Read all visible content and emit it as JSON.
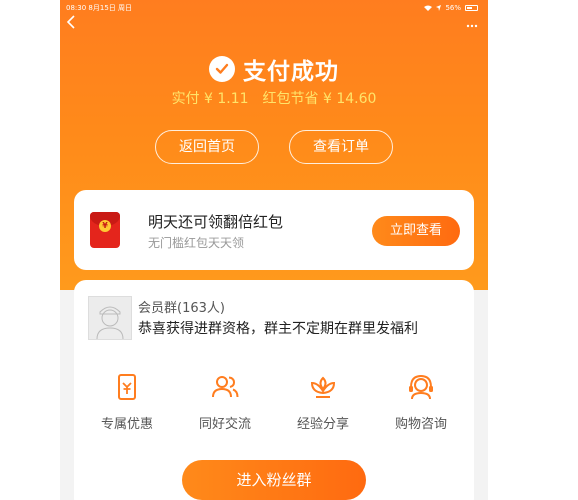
{
  "status_bar": {
    "time": "08:30",
    "date": "8月15日 周日",
    "battery": "56%"
  },
  "header": {
    "back_icon": "chevron-left-icon",
    "more_icon": "more-dots-icon",
    "title": "支付成功",
    "paid_label": "实付 ¥ 1.11",
    "saved_label": "红包节省 ¥ 14.60",
    "home_button": "返回首页",
    "order_button": "查看订单"
  },
  "promo": {
    "title": "明天还可领翻倍红包",
    "subtitle": "无门槛红包天天领",
    "button": "立即查看",
    "coin_symbol": "¥"
  },
  "group": {
    "name": "会员群(163人)",
    "message": "恭喜获得进群资格，群主不定期在群里发福利",
    "features": [
      {
        "label": "专属优惠",
        "icon": "coupon-icon"
      },
      {
        "label": "同好交流",
        "icon": "users-icon"
      },
      {
        "label": "经验分享",
        "icon": "lotus-icon"
      },
      {
        "label": "购物咨询",
        "icon": "headset-icon"
      }
    ],
    "join_button": "进入粉丝群"
  },
  "colors": {
    "accent": "#ff7d1f",
    "gold_text": "#ffe46a",
    "red_packet": "#e4251c"
  }
}
